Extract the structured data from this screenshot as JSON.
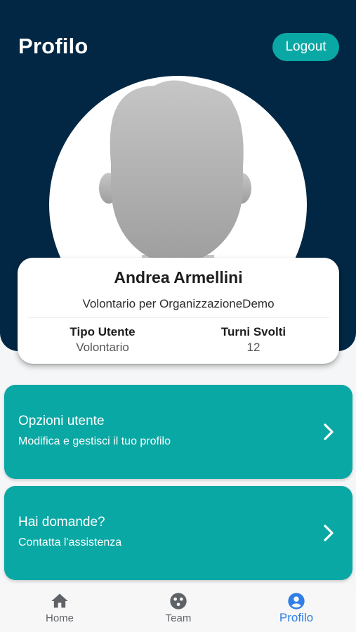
{
  "header": {
    "title": "Profilo",
    "logout_label": "Logout"
  },
  "profile": {
    "name": "Andrea Armellini",
    "role": "Volontario per OrganizzazioneDemo",
    "stats": [
      {
        "label": "Tipo Utente",
        "value": "Volontario"
      },
      {
        "label": "Turni Svolti",
        "value": "12"
      }
    ]
  },
  "menu": [
    {
      "title": "Opzioni utente",
      "subtitle": "Modifica e gestisci il tuo profilo",
      "icon": "chevron-right-icon"
    },
    {
      "title": "Hai domande?",
      "subtitle": "Contatta l'assistenza",
      "icon": "chevron-right-icon"
    }
  ],
  "nav": {
    "items": [
      {
        "label": "Home",
        "icon": "home-icon"
      },
      {
        "label": "Team",
        "icon": "team-icon"
      },
      {
        "label": "Profilo",
        "icon": "account-circle-icon",
        "active": true
      }
    ]
  },
  "colors": {
    "header_bg": "#012744",
    "accent": "#0aa8a4",
    "nav_active": "#2f7fe6",
    "nav_inactive": "#5f6368"
  }
}
